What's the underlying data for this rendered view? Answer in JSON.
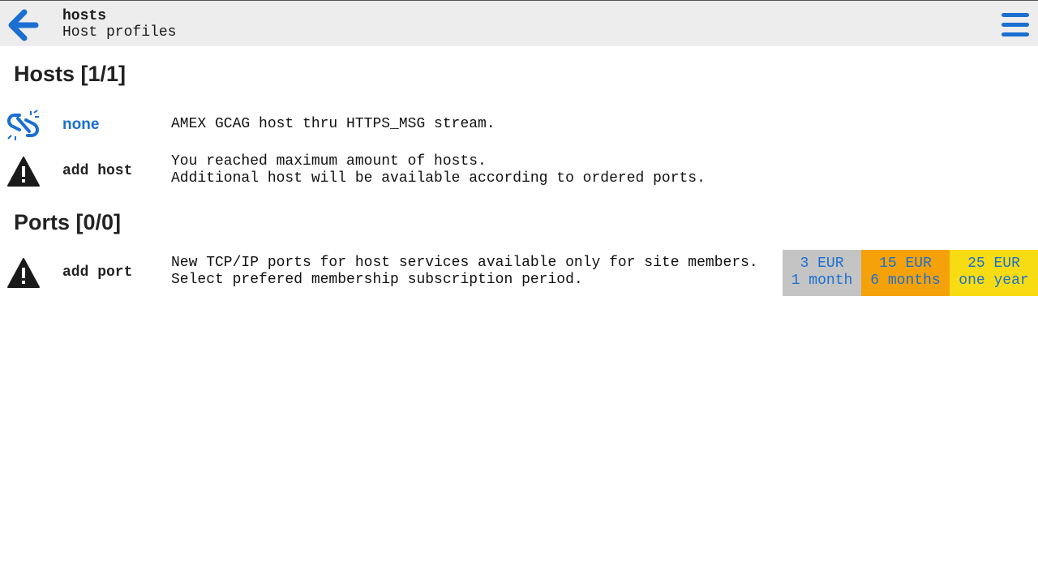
{
  "header": {
    "title": "hosts",
    "subtitle": "Host profiles",
    "back_icon": "arrow-left-icon",
    "menu_icon": "hamburger-menu-icon"
  },
  "hosts_section": {
    "title": "Hosts [1/1]",
    "rows": [
      {
        "icon": "broken-link-icon",
        "label": "none",
        "desc_line1": "AMEX GCAG host thru HTTPS_MSG stream.",
        "desc_line2": ""
      },
      {
        "icon": "warning-icon",
        "label": "add host",
        "desc_line1": "You reached maximum amount of hosts.",
        "desc_line2": "Additional host will be available according to ordered ports."
      }
    ]
  },
  "ports_section": {
    "title": "Ports [0/0]",
    "row": {
      "icon": "warning-icon",
      "label": "add port",
      "desc_line1": "New TCP/IP ports for host services available only for site members.",
      "desc_line2": "Select prefered membership subscription period."
    },
    "prices": [
      {
        "price": "3 EUR",
        "period": "1 month",
        "color": "#c4c4c4"
      },
      {
        "price": "15 EUR",
        "period": "6 months",
        "color": "#f5a20a"
      },
      {
        "price": "25 EUR",
        "period": "one year",
        "color": "#f7dc14"
      }
    ]
  },
  "colors": {
    "accent": "#1a6fd1",
    "topbar": "#ededed"
  }
}
